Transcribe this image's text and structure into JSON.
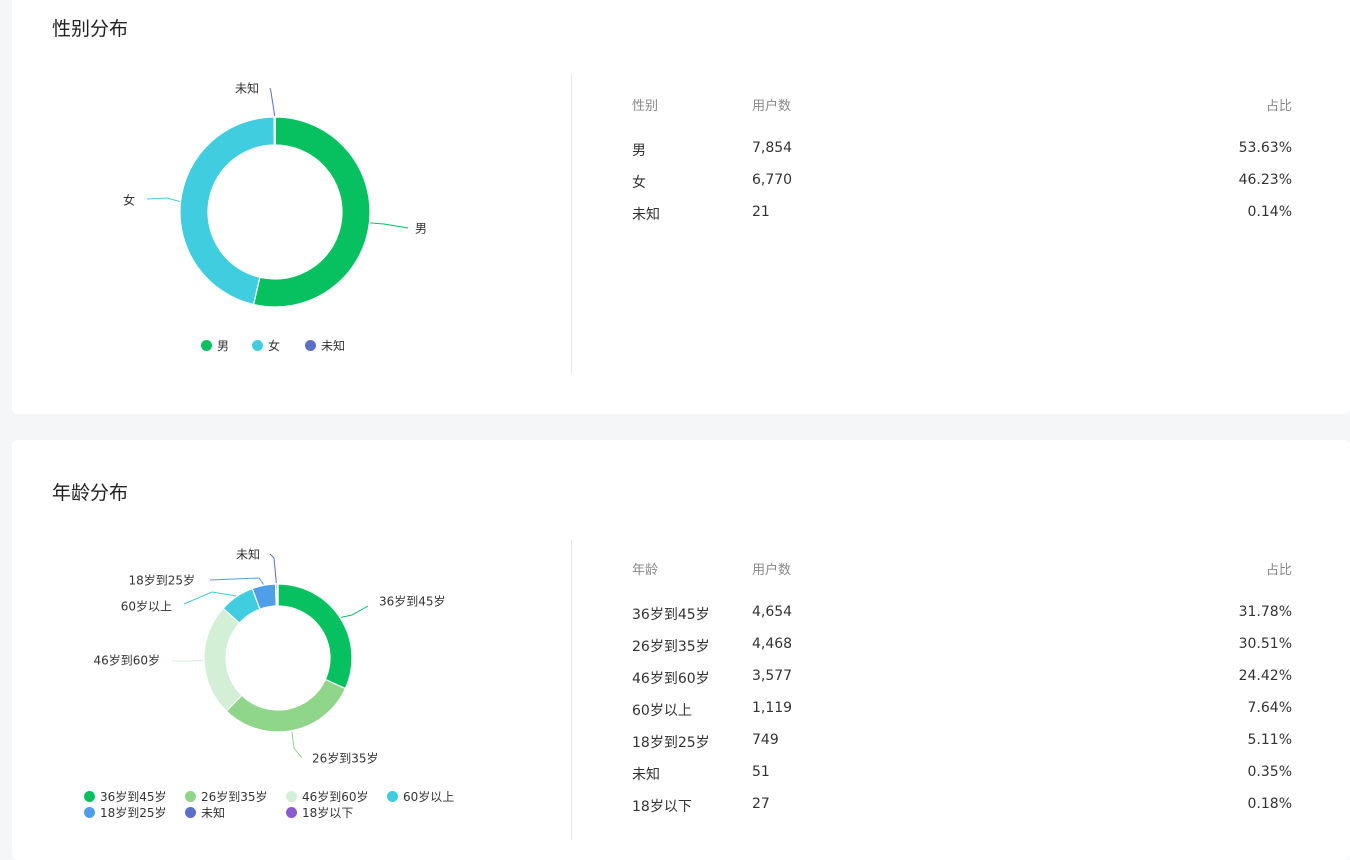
{
  "colors": {
    "green": "#07c160",
    "cyan": "#40cde0",
    "indigo": "#5b6fc9",
    "light_green": "#8fd68a",
    "pale_green": "#d3efd6",
    "blue": "#4f9ee8",
    "purple": "#8a5bd0"
  },
  "gender": {
    "title": "性别分布",
    "table": {
      "headers": [
        "性别",
        "用户数",
        "占比"
      ],
      "rows": [
        [
          "男",
          "7,854",
          "53.63%"
        ],
        [
          "女",
          "6,770",
          "46.23%"
        ],
        [
          "未知",
          "21",
          "0.14%"
        ]
      ]
    }
  },
  "age": {
    "title": "年龄分布",
    "table": {
      "headers": [
        "年龄",
        "用户数",
        "占比"
      ],
      "rows": [
        [
          "36岁到45岁",
          "4,654",
          "31.78%"
        ],
        [
          "26岁到35岁",
          "4,468",
          "30.51%"
        ],
        [
          "46岁到60岁",
          "3,577",
          "24.42%"
        ],
        [
          "60岁以上",
          "1,119",
          "7.64%"
        ],
        [
          "18岁到25岁",
          "749",
          "5.11%"
        ],
        [
          "未知",
          "51",
          "0.35%"
        ],
        [
          "18岁以下",
          "27",
          "0.18%"
        ]
      ]
    }
  },
  "chart_data": [
    {
      "type": "pie",
      "donut": true,
      "title": "",
      "categories": [
        "男",
        "女",
        "未知"
      ],
      "values": [
        7854,
        6770,
        21
      ],
      "colors": [
        "#07c160",
        "#40cde0",
        "#5b6fc9"
      ],
      "legend": "bottom"
    },
    {
      "type": "pie",
      "donut": true,
      "title": "",
      "categories": [
        "36岁到45岁",
        "26岁到35岁",
        "46岁到60岁",
        "60岁以上",
        "18岁到25岁",
        "未知",
        "18岁以下"
      ],
      "values": [
        4654,
        4468,
        3577,
        1119,
        749,
        51,
        27
      ],
      "colors": [
        "#07c160",
        "#8fd68a",
        "#d3efd6",
        "#40cde0",
        "#4f9ee8",
        "#5b6fc9",
        "#8a5bd0"
      ],
      "legend": "bottom"
    }
  ]
}
